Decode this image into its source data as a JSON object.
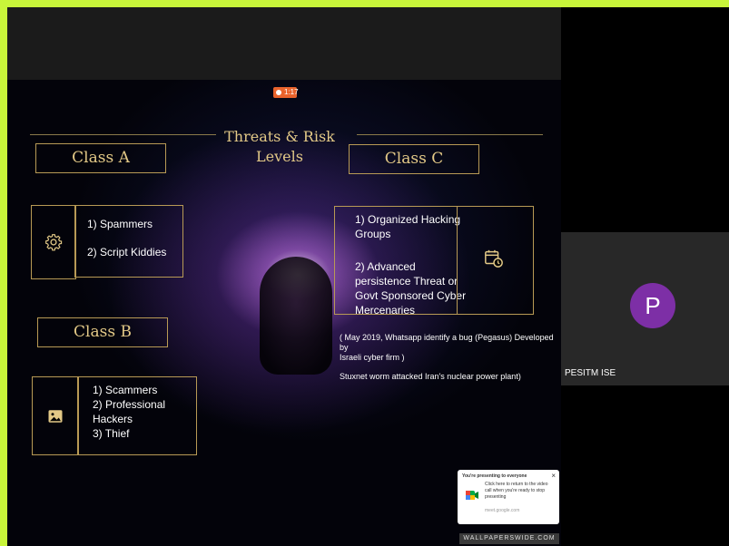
{
  "recording_badge": "1:17",
  "slide": {
    "title_line1": "Threats & Risk",
    "title_line2": "Levels",
    "class_a": {
      "heading": "Class A",
      "items": [
        "1)  Spammers",
        "2)  Script Kiddies"
      ],
      "icon": "gear-icon"
    },
    "class_b": {
      "heading": "Class B",
      "items": [
        "1) Scammers",
        "2) Professional",
        "Hackers",
        "3) Thief"
      ],
      "icon": "image-icon"
    },
    "class_c": {
      "heading": "Class C",
      "items": [
        "1) Organized Hacking",
        "Groups",
        "",
        "2) Advanced",
        "persistence Threat or",
        "Govt  Sponsored Cyber",
        "Mercenaries"
      ],
      "icon": "calendar-clock-icon"
    },
    "note1_line1": "( May 2019, Whatsapp identify a bug (Pegasus)  Developed by",
    "note1_line2": "Israeli cyber firm )",
    "note2": "Stuxnet worm attacked Iran's nuclear power plant)",
    "wallpaper_tag": "WALLPAPERSWIDE.COM"
  },
  "notification": {
    "title": "You're presenting to everyone",
    "body": "Click here to return to the video call when you're ready to stop presenting",
    "link": "meet.google.com",
    "close": "×",
    "icon": "google-meet-icon"
  },
  "participant": {
    "initial": "P",
    "name": "PESITM ISE",
    "avatar_color": "#7d2fa6"
  },
  "colors": {
    "frame_border": "#c8f53a",
    "slide_gold": "#e3c987",
    "box_border": "#b89a55"
  }
}
